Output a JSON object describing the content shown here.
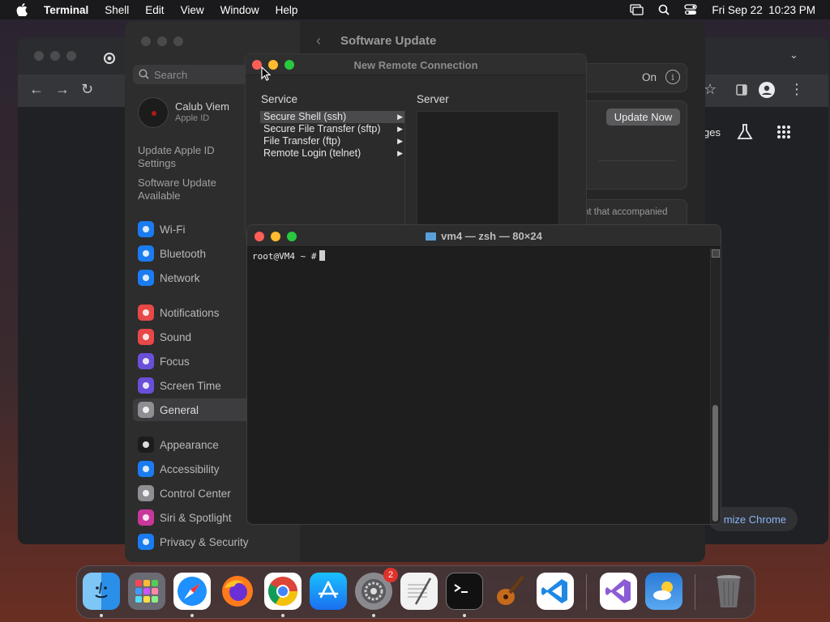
{
  "menubar": {
    "app_name": "Terminal",
    "items": [
      "Shell",
      "Edit",
      "View",
      "Window",
      "Help"
    ],
    "datetime": "Fri Sep 22  10:23 PM"
  },
  "settings": {
    "search_placeholder": "Search",
    "account_name": "Calub Viem",
    "account_sub": "Apple ID",
    "notice_1": "Update Apple ID Settings",
    "notice_2": "Software Update Available",
    "sidebar_items": [
      {
        "label": "Wi-Fi",
        "color": "#1a7cf0",
        "icon": "wifi-icon"
      },
      {
        "label": "Bluetooth",
        "color": "#1a7cf0",
        "icon": "bluetooth-icon"
      },
      {
        "label": "Network",
        "color": "#1a7cf0",
        "icon": "globe-icon"
      },
      {
        "label": "Notifications",
        "color": "#e84848",
        "icon": "bell-icon"
      },
      {
        "label": "Sound",
        "color": "#e84848",
        "icon": "speaker-icon"
      },
      {
        "label": "Focus",
        "color": "#6a4fd8",
        "icon": "moon-icon"
      },
      {
        "label": "Screen Time",
        "color": "#6a4fd8",
        "icon": "hourglass-icon"
      },
      {
        "label": "General",
        "color": "#8e8e93",
        "icon": "gear-icon"
      },
      {
        "label": "Appearance",
        "color": "#1c1c1e",
        "icon": "appearance-icon"
      },
      {
        "label": "Accessibility",
        "color": "#1a7cf0",
        "icon": "accessibility-icon"
      },
      {
        "label": "Control Center",
        "color": "#8e8e93",
        "icon": "control-center-icon"
      },
      {
        "label": "Siri & Spotlight",
        "color": "#c8389a",
        "icon": "siri-icon"
      },
      {
        "label": "Privacy & Security",
        "color": "#1a7cf0",
        "icon": "hand-icon"
      }
    ],
    "selected_item": "General",
    "content_title": "Software Update",
    "auto_updates_value": "On",
    "update_now_label": "Update Now",
    "accompanied_text": "nt that accompanied"
  },
  "chrome": {
    "pages_fragment": "ges",
    "customize_label": "mize Chrome"
  },
  "remote_connection": {
    "title": "New Remote Connection",
    "service_label": "Service",
    "server_label": "Server",
    "services": [
      "Secure Shell (ssh)",
      "Secure File Transfer (sftp)",
      "File Transfer (ftp)",
      "Remote Login (telnet)"
    ],
    "selected_service": "Secure Shell (ssh)"
  },
  "terminal": {
    "title": "vm4 — zsh — 80×24",
    "prompt": "root@VM4 ~ #"
  },
  "dock": {
    "apps": [
      {
        "name": "finder",
        "icon": "finder-icon",
        "running": true
      },
      {
        "name": "launchpad",
        "icon": "launchpad-icon",
        "running": false
      },
      {
        "name": "safari",
        "icon": "safari-icon",
        "running": true
      },
      {
        "name": "firefox",
        "icon": "firefox-icon",
        "running": false
      },
      {
        "name": "chrome",
        "icon": "chrome-icon",
        "running": true
      },
      {
        "name": "app-store",
        "icon": "app-store-icon",
        "running": false
      },
      {
        "name": "system-settings",
        "icon": "system-settings-icon",
        "running": true,
        "badge": "2"
      },
      {
        "name": "textedit",
        "icon": "textedit-icon",
        "running": false
      },
      {
        "name": "terminal",
        "icon": "terminal-icon",
        "running": true
      },
      {
        "name": "garageband",
        "icon": "garageband-icon",
        "running": false
      },
      {
        "name": "vscode",
        "icon": "vscode-icon",
        "running": false
      },
      {
        "name": "visual-studio",
        "icon": "visual-studio-icon",
        "running": false
      },
      {
        "name": "weather",
        "icon": "weather-icon",
        "running": false
      },
      {
        "name": "trash",
        "icon": "trash-icon",
        "running": false
      }
    ]
  }
}
